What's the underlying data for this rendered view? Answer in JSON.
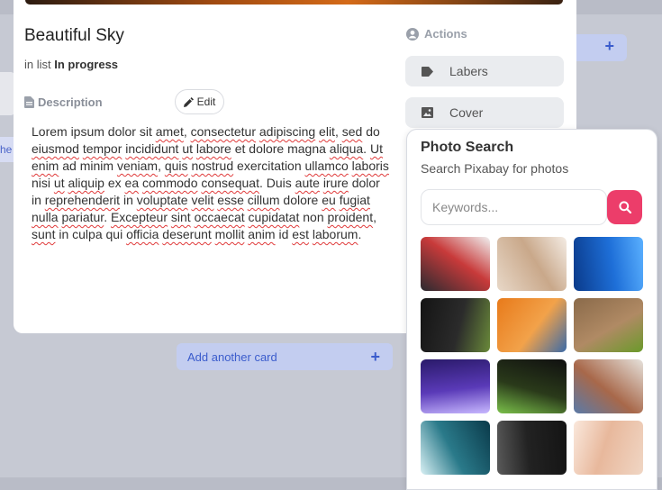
{
  "card": {
    "title": "Beautiful Sky",
    "list_prefix": "in list ",
    "list_name": "In progress"
  },
  "description": {
    "label": "Description",
    "edit_label": "Edit",
    "segments": [
      {
        "t": "Lorem ipsum dolor sit ",
        "s": false
      },
      {
        "t": "amet",
        "s": true
      },
      {
        "t": ", ",
        "s": false
      },
      {
        "t": "consectetur",
        "s": true
      },
      {
        "t": " ",
        "s": false
      },
      {
        "t": "adipiscing",
        "s": true
      },
      {
        "t": " ",
        "s": false
      },
      {
        "t": "elit",
        "s": true
      },
      {
        "t": ", ",
        "s": false
      },
      {
        "t": "sed",
        "s": true
      },
      {
        "t": " do ",
        "s": false
      },
      {
        "t": "eiusmod",
        "s": true
      },
      {
        "t": " ",
        "s": false
      },
      {
        "t": "tempor",
        "s": true
      },
      {
        "t": " ",
        "s": false
      },
      {
        "t": "incididunt",
        "s": true
      },
      {
        "t": " ",
        "s": false
      },
      {
        "t": "ut",
        "s": true
      },
      {
        "t": " ",
        "s": false
      },
      {
        "t": "labore",
        "s": true
      },
      {
        "t": " et dolore magna ",
        "s": false
      },
      {
        "t": "aliqua",
        "s": true
      },
      {
        "t": ". ",
        "s": false
      },
      {
        "t": "Ut",
        "s": true
      },
      {
        "t": " ",
        "s": false
      },
      {
        "t": "enim",
        "s": true
      },
      {
        "t": " ad minim ",
        "s": false
      },
      {
        "t": "veniam",
        "s": true
      },
      {
        "t": ", ",
        "s": false
      },
      {
        "t": "quis",
        "s": true
      },
      {
        "t": " ",
        "s": false
      },
      {
        "t": "nostrud",
        "s": true
      },
      {
        "t": " exercitation ",
        "s": false
      },
      {
        "t": "ullamco",
        "s": true
      },
      {
        "t": " ",
        "s": false
      },
      {
        "t": "laboris",
        "s": true
      },
      {
        "t": " nisi ",
        "s": false
      },
      {
        "t": "ut",
        "s": true
      },
      {
        "t": " ",
        "s": false
      },
      {
        "t": "aliquip",
        "s": true
      },
      {
        "t": " ex ",
        "s": false
      },
      {
        "t": "ea",
        "s": true
      },
      {
        "t": " ",
        "s": false
      },
      {
        "t": "commodo",
        "s": true
      },
      {
        "t": " ",
        "s": false
      },
      {
        "t": "consequat",
        "s": true
      },
      {
        "t": ". Duis ",
        "s": false
      },
      {
        "t": "aute",
        "s": true
      },
      {
        "t": " ",
        "s": false
      },
      {
        "t": "irure",
        "s": true
      },
      {
        "t": " dolor in ",
        "s": false
      },
      {
        "t": "reprehenderit",
        "s": true
      },
      {
        "t": " in ",
        "s": false
      },
      {
        "t": "voluptate",
        "s": true
      },
      {
        "t": " ",
        "s": false
      },
      {
        "t": "velit",
        "s": true
      },
      {
        "t": " ",
        "s": false
      },
      {
        "t": "esse",
        "s": true
      },
      {
        "t": " ",
        "s": false
      },
      {
        "t": "cillum",
        "s": true
      },
      {
        "t": " dolore ",
        "s": false
      },
      {
        "t": "eu",
        "s": true
      },
      {
        "t": " ",
        "s": false
      },
      {
        "t": "fugiat",
        "s": true
      },
      {
        "t": " ",
        "s": false
      },
      {
        "t": "nulla",
        "s": true
      },
      {
        "t": " ",
        "s": false
      },
      {
        "t": "pariatur",
        "s": true
      },
      {
        "t": ". ",
        "s": false
      },
      {
        "t": "Excepteur",
        "s": true
      },
      {
        "t": " ",
        "s": false
      },
      {
        "t": "sint",
        "s": true
      },
      {
        "t": " ",
        "s": false
      },
      {
        "t": "occaecat",
        "s": true
      },
      {
        "t": " ",
        "s": false
      },
      {
        "t": "cupidatat",
        "s": true
      },
      {
        "t": " non ",
        "s": false
      },
      {
        "t": "proident",
        "s": true
      },
      {
        "t": ", ",
        "s": false
      },
      {
        "t": "sunt",
        "s": true
      },
      {
        "t": " in culpa qui ",
        "s": false
      },
      {
        "t": "officia",
        "s": true
      },
      {
        "t": " ",
        "s": false
      },
      {
        "t": "deserunt",
        "s": true
      },
      {
        "t": " ",
        "s": false
      },
      {
        "t": "mollit",
        "s": true
      },
      {
        "t": " ",
        "s": false
      },
      {
        "t": "anim",
        "s": true
      },
      {
        "t": " id ",
        "s": false
      },
      {
        "t": "est",
        "s": true
      },
      {
        "t": " ",
        "s": false
      },
      {
        "t": "laborum",
        "s": true
      },
      {
        "t": ".",
        "s": false
      }
    ]
  },
  "actions": {
    "label": "Actions",
    "buttons": [
      {
        "label": "Labers",
        "icon": "tag-icon"
      },
      {
        "label": "Cover",
        "icon": "image-icon"
      }
    ]
  },
  "background": {
    "left_chip_text": "he",
    "plus": "+"
  },
  "add_card": {
    "label": "Add another card",
    "plus": "+"
  },
  "photo_search": {
    "title": "Photo Search",
    "subtitle": "Search Pixabay for photos",
    "placeholder": "Keywords...",
    "value": "",
    "thumbnails": [
      {
        "name": "desk-computer-photo",
        "colors": [
          "#2a2a30",
          "#c83a3a",
          "#f0f0f0"
        ]
      },
      {
        "name": "workspace-tablet-photo",
        "colors": [
          "#e8d8c8",
          "#c9a88a",
          "#f4ece4"
        ]
      },
      {
        "name": "dna-helix-photo",
        "colors": [
          "#0a3a8a",
          "#1e6fd8",
          "#5ab0ff"
        ]
      },
      {
        "name": "code-screen-photo",
        "colors": [
          "#141414",
          "#2b2b2b",
          "#6a8a3a"
        ]
      },
      {
        "name": "writing-desk-photo",
        "colors": [
          "#e87a1a",
          "#f2a24a",
          "#3a6aa8"
        ]
      },
      {
        "name": "cracked-earth-flower-photo",
        "colors": [
          "#8a6a4a",
          "#b08a64",
          "#6a9a2a"
        ]
      },
      {
        "name": "lightning-storm-photo",
        "colors": [
          "#2a1a6a",
          "#5a3ab8",
          "#c8b8ff"
        ]
      },
      {
        "name": "code-editor-photo",
        "colors": [
          "#101010",
          "#2a3a1a",
          "#7ac04a"
        ]
      },
      {
        "name": "house-rooftop-photo",
        "colors": [
          "#e6e2dc",
          "#a8684a",
          "#5a7aa8"
        ]
      },
      {
        "name": "stock-chart-photo",
        "colors": [
          "#0a3a4a",
          "#2a7a8a",
          "#d8f0f4"
        ]
      },
      {
        "name": "terminal-text-photo",
        "colors": [
          "#141414",
          "#222222",
          "#5a5a5a"
        ]
      },
      {
        "name": "hands-heart-photo",
        "colors": [
          "#f0d6c4",
          "#e8b89c",
          "#fae8dc"
        ]
      }
    ]
  }
}
